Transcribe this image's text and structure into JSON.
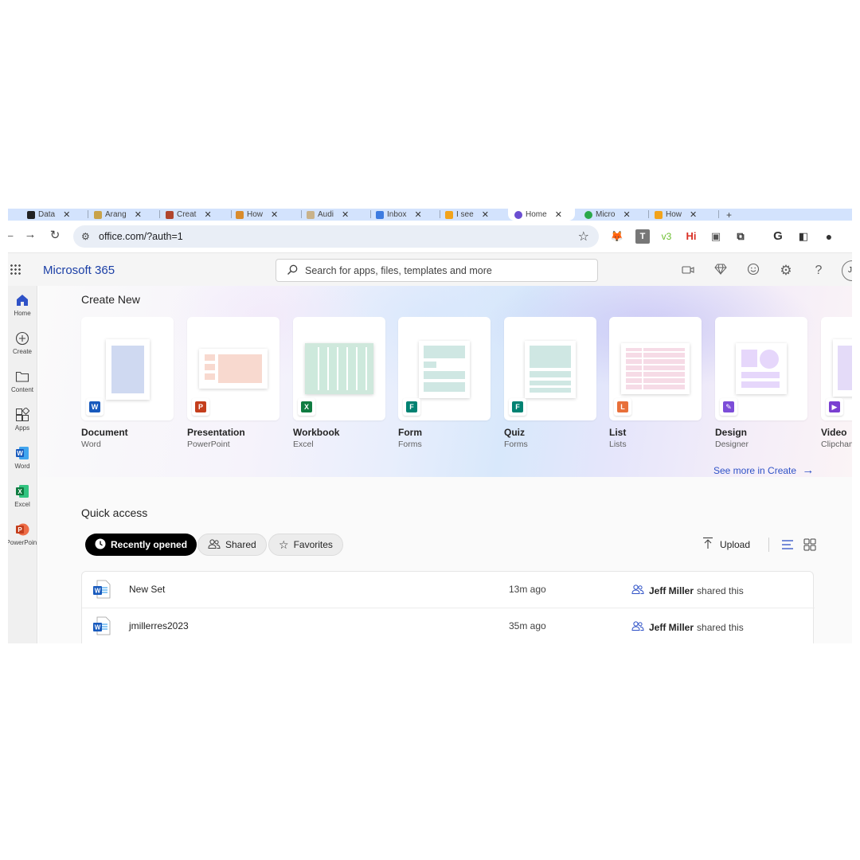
{
  "browser": {
    "tabs": [
      {
        "label": "Data",
        "favicon": "#222222"
      },
      {
        "label": "Arang",
        "favicon": "#c8a24a"
      },
      {
        "label": "Creat",
        "favicon": "#b0452e"
      },
      {
        "label": "How",
        "favicon": "#d98b2b"
      },
      {
        "label": "Audi",
        "favicon": "#c9b28a"
      },
      {
        "label": "Inbox",
        "favicon": "#3d7be0"
      },
      {
        "label": "I see",
        "favicon": "#f2a31b"
      },
      {
        "label": "Home",
        "favicon": "#6b4ed1",
        "active": true
      },
      {
        "label": "Micro",
        "favicon": "#2aa84a"
      },
      {
        "label": "How",
        "favicon": "#f2a31b"
      }
    ],
    "url": "office.com/?auth=1"
  },
  "header": {
    "brand": "Microsoft 365",
    "search_placeholder": "Search for apps, files, templates and more",
    "avatar_initials": "JM"
  },
  "rail": {
    "items": [
      {
        "label": "Home",
        "icon": "home-icon"
      },
      {
        "label": "Create",
        "icon": "plus-circle-icon"
      },
      {
        "label": "Content",
        "icon": "folder-icon"
      },
      {
        "label": "Apps",
        "icon": "apps-icon"
      },
      {
        "label": "Word",
        "icon": "word-icon"
      },
      {
        "label": "Excel",
        "icon": "excel-icon"
      },
      {
        "label": "PowerPoint",
        "icon": "powerpoint-icon"
      }
    ]
  },
  "create": {
    "title": "Create New",
    "cards": [
      {
        "title": "Document",
        "app": "Word",
        "color": "#185abd"
      },
      {
        "title": "Presentation",
        "app": "PowerPoint",
        "color": "#c43e1c"
      },
      {
        "title": "Workbook",
        "app": "Excel",
        "color": "#107c41"
      },
      {
        "title": "Form",
        "app": "Forms",
        "color": "#008272"
      },
      {
        "title": "Quiz",
        "app": "Forms",
        "color": "#008272"
      },
      {
        "title": "List",
        "app": "Lists",
        "color": "#e8703a"
      },
      {
        "title": "Design",
        "app": "Designer",
        "color": "#7c4dd8"
      },
      {
        "title": "Video",
        "app": "Clipchamp",
        "color": "#7a3fd1"
      }
    ],
    "see_more": "See more in Create"
  },
  "quick_access": {
    "title": "Quick access",
    "filters": [
      "Recently opened",
      "Shared",
      "Favorites"
    ],
    "upload_label": "Upload",
    "files": [
      {
        "name": "New Set",
        "time": "13m ago",
        "sharer": "Jeff Miller",
        "activity": "shared this"
      },
      {
        "name": "jmillerres2023",
        "time": "35m ago",
        "sharer": "Jeff Miller",
        "activity": "shared this"
      }
    ]
  }
}
